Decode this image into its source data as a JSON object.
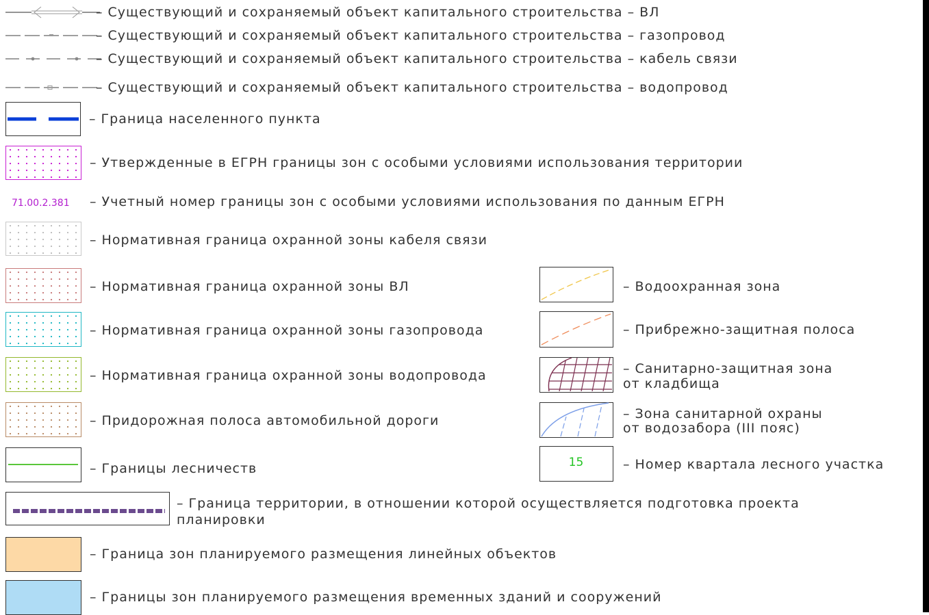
{
  "colors": {
    "settlement_border": "#0a3fd8",
    "egrn_zone": "#c81ed3",
    "egrn_number": "#b31ecf",
    "cable_zone": "#c9c9c9",
    "vl_zone": "#c87b7b",
    "gas_zone": "#1fb7c4",
    "water_zone": "#93b82c",
    "road_strip": "#b88a65",
    "forestry": "#5ac63a",
    "water_protection": "#f0c64a",
    "coastal_strip": "#ef8c5a",
    "cemetery_zone": "#7b2d4e",
    "water_intake_zone": "#7b9ee8",
    "forest_quarter_number": "#23c423",
    "project_border": "#6b4b8e",
    "linear_objects_fill": "#fdd9a6",
    "temporary_buildings_fill": "#afdcf5"
  },
  "legend": {
    "existing_vl": "– Существующий и сохраняемый объект капитального строительства – ВЛ",
    "existing_gas": "– Существующий и сохраняемый объект капитального строительства – газопровод",
    "existing_cable": "– Существующий и сохраняемый объект капитального строительства – кабель связи",
    "existing_water": "– Существующий и сохраняемый объект капитального строительства – водопровод",
    "settlement_border": "– Граница населенного пункта",
    "egrn_zones": "– Утвержденные в ЕГРН границы зон с особыми условиями использования территории",
    "egrn_number_sample": "71.00.2.381",
    "egrn_number": "– Учетный номер границы зон с особыми условиями использования по данным ЕГРН",
    "cable_zone": "– Нормативная граница охранной зоны кабеля связи",
    "vl_zone": "– Нормативная граница охранной зоны ВЛ",
    "gas_zone": "– Нормативная граница охранной зоны газопровода",
    "water_zone": "– Нормативная граница охранной зоны водопровода",
    "road_strip": "– Придорожная полоса автомобильной дороги",
    "forestry": "– Границы лесничеств",
    "water_protection": "– Водоохранная зона",
    "coastal_strip": "– Прибрежно-защитная полоса",
    "cemetery_zone_1": "– Санитарно-защитная зона",
    "cemetery_zone_2": "от кладбища",
    "water_intake_zone_1": "– Зона санитарной охраны",
    "water_intake_zone_2": "от водозабора (III пояс)",
    "forest_quarter_sample": "15",
    "forest_quarter": "– Номер квартала лесного участка",
    "project_border_1": "– Граница территории, в отношении которой осуществляется подготовка проекта",
    "project_border_2": "планировки",
    "linear_objects": "– Граница зон планируемого размещения линейных объектов",
    "temporary_buildings": "– Границы зон планируемого размещения временных зданий и сооружений"
  }
}
